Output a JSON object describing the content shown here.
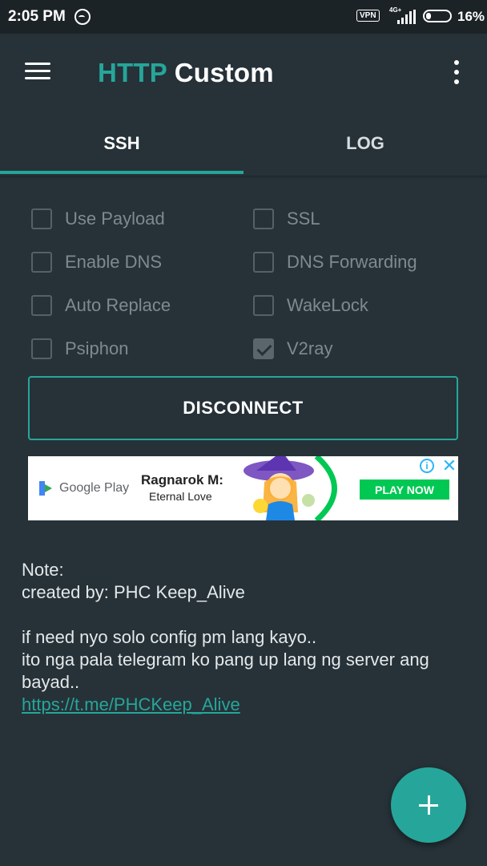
{
  "status_bar": {
    "time": "2:05 PM",
    "vpn_label": "VPN",
    "network": "4G+",
    "battery_pct": "16%",
    "icons": [
      "clock-icon",
      "vpn-icon",
      "signal-icon",
      "battery-icon"
    ]
  },
  "app_bar": {
    "title_accent": "HTTP",
    "title_rest": "Custom",
    "menu_icon": "hamburger-menu-icon",
    "overflow_icon": "more-vert-icon"
  },
  "tabs": [
    {
      "label": "SSH",
      "selected": true
    },
    {
      "label": "LOG",
      "selected": false
    }
  ],
  "options": [
    {
      "label": "Use Payload",
      "checked": false
    },
    {
      "label": "SSL",
      "checked": false
    },
    {
      "label": "Enable DNS",
      "checked": false
    },
    {
      "label": "DNS Forwarding",
      "checked": false
    },
    {
      "label": "Auto Replace",
      "checked": false
    },
    {
      "label": "WakeLock",
      "checked": false
    },
    {
      "label": "Psiphon",
      "checked": false
    },
    {
      "label": "V2ray",
      "checked": true
    }
  ],
  "disconnect_label": "DISCONNECT",
  "ad": {
    "store": "Google Play",
    "title": "Ragnarok M:",
    "subtitle": "Eternal Love",
    "cta": "PLAY NOW"
  },
  "note": {
    "line1": "Note:",
    "line2": "created by: PHC Keep_Alive",
    "line3": "if need nyo solo config pm lang kayo..",
    "line4": "ito nga pala telegram ko pang up lang ng server ang bayad..",
    "link": "https://t.me/PHCKeep_Alive"
  },
  "colors": {
    "accent": "#26a69a",
    "background": "#263238",
    "status_bar": "#1c2327"
  }
}
